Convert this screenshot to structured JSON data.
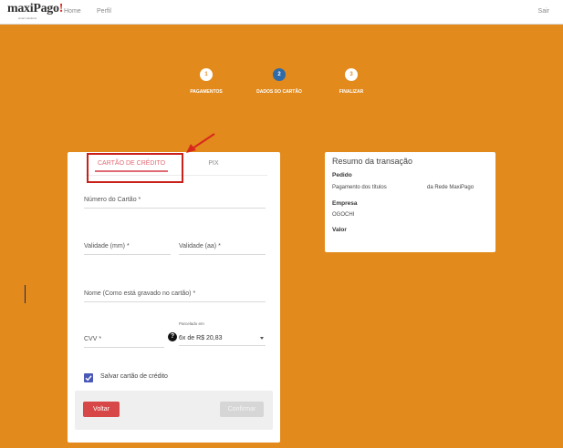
{
  "header": {
    "logo_main": "maxiPago",
    "logo_mark": "!",
    "logo_tagline": "smart solutions",
    "nav": [
      "Home",
      "Perfil"
    ],
    "logout": "Sair"
  },
  "stepper": {
    "steps": [
      {
        "number": "1",
        "label": "PAGAMENTOS"
      },
      {
        "number": "2",
        "label": "DADOS DO CARTÃO"
      },
      {
        "number": "3",
        "label": "FINALIZAR"
      }
    ],
    "active_step": 2
  },
  "payment_form": {
    "tabs": {
      "credit": "CARTÃO DE CRÉDITO",
      "pix": "PIX"
    },
    "active_tab": "credit",
    "fields": {
      "card_number": "Número do Cartão *",
      "exp_month": "Validade (mm) *",
      "exp_year": "Validade (aa) *",
      "holder_name": "Nome (Como está gravado no cartão) *",
      "cvv": "CVV *"
    },
    "installments": {
      "label": "Parcelado em",
      "selected": "6x de R$ 20,83"
    },
    "help_icon": "?",
    "save_card": {
      "label": "Salvar cartão de crédito",
      "checked": true
    },
    "buttons": {
      "back": "Voltar",
      "confirm": "Confirmar"
    }
  },
  "summary": {
    "title": "Resumo da transação",
    "order_label": "Pedido",
    "order_value": "Pagamento dos títulos",
    "order_value_right": "da Rede MaxiPago",
    "company_label": "Empresa",
    "company_value": "OGOCHI",
    "value_label": "Valor"
  },
  "colors": {
    "background": "#e28a1c",
    "active_step": "#2f6ba7",
    "tab_accent": "#e06a74",
    "highlight": "#c8201a",
    "back_button": "#d74747",
    "checkbox": "#4a58b8"
  }
}
